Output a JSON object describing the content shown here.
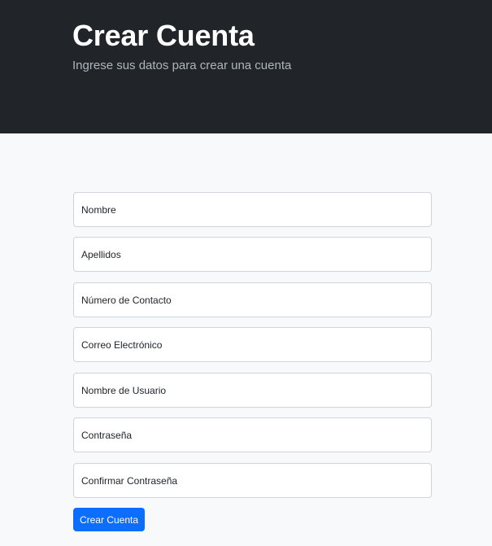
{
  "header": {
    "title": "Crear Cuenta",
    "subtitle": "Ingrese sus datos para crear una cuenta"
  },
  "form": {
    "fields": [
      {
        "placeholder": "Nombre"
      },
      {
        "placeholder": "Apellidos"
      },
      {
        "placeholder": "Número de Contacto"
      },
      {
        "placeholder": "Correo Electrónico"
      },
      {
        "placeholder": "Nombre de Usuario"
      },
      {
        "placeholder": "Contraseña"
      },
      {
        "placeholder": "Confirmar Contraseña"
      }
    ],
    "submit_label": "Crear Cuenta"
  },
  "colors": {
    "header_bg": "#212529",
    "page_bg": "#f8f9fa",
    "accent": "#0d6efd"
  }
}
